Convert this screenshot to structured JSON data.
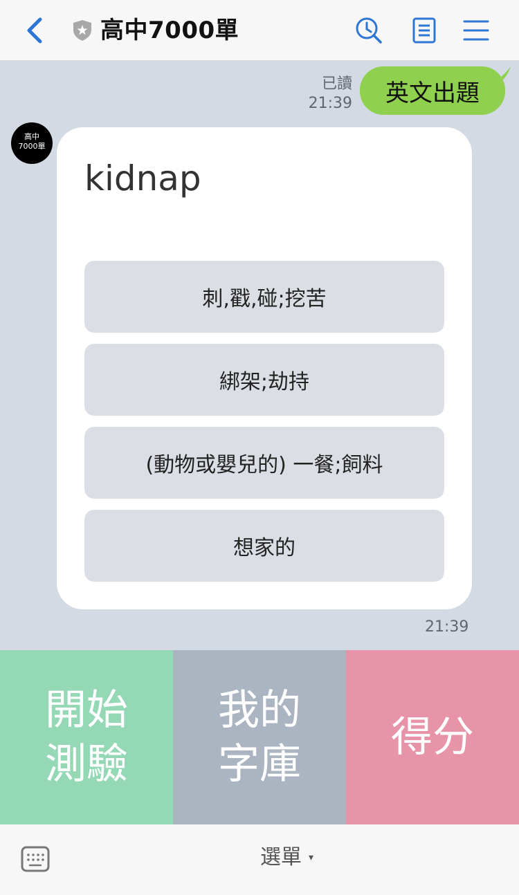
{
  "header": {
    "title": "高中7000單",
    "icons": [
      "back-icon",
      "official-account-shield-icon",
      "search-history-icon",
      "note-icon",
      "hamburger-menu-icon"
    ]
  },
  "chat": {
    "outgoing": {
      "text": "英文出題",
      "read_status": "已讀",
      "time": "21:39",
      "bubble_color": "#8fd14f"
    },
    "avatar": {
      "line1": "高中",
      "line2": "7000單"
    },
    "quiz": {
      "word": "kidnap",
      "options": [
        "刺,戳,碰;挖苦",
        "綁架;劫持",
        "(動物或嬰兒的) 一餐;飼料",
        "想家的"
      ],
      "time": "21:39"
    }
  },
  "rich_menu": {
    "tiles": [
      {
        "line1": "開始",
        "line2": "測驗",
        "color": "#94d8b5"
      },
      {
        "line1": "我的",
        "line2": "字庫",
        "color": "#abb5c2"
      },
      {
        "line1": "得分",
        "line2": "",
        "color": "#e794a8"
      }
    ]
  },
  "bottom_bar": {
    "menu_label": "選單",
    "caret": "▾"
  },
  "colors": {
    "accent": "#2e76d6",
    "chat_bg": "#d3dae3"
  }
}
